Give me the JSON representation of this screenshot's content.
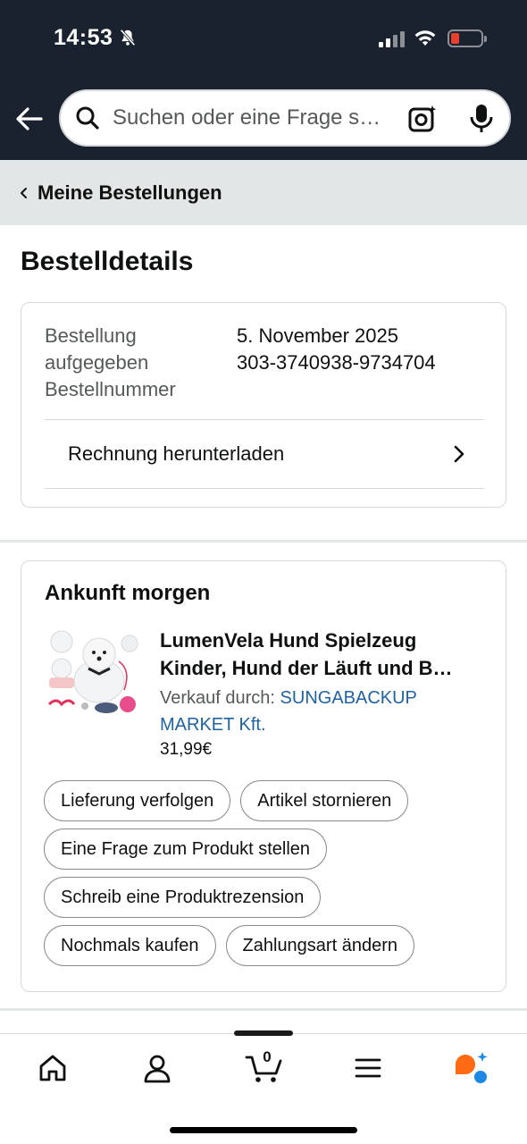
{
  "status_bar": {
    "time": "14:53"
  },
  "search": {
    "placeholder": "Suchen oder eine Frage s…"
  },
  "breadcrumb": {
    "label": "Meine Bestellungen"
  },
  "page": {
    "title": "Bestelldetails"
  },
  "order_info": {
    "label_placed": "Bestellung",
    "label_placed_2": "aufgegeben",
    "label_number": "Bestellnummer",
    "date": "5. November 2025",
    "number": "303-3740938-9734704",
    "invoice_label": "Rechnung herunterladen"
  },
  "shipment": {
    "heading": "Ankunft morgen",
    "product_title": "LumenVela Hund Spielzeug Kinder, Hund der Läuft und B…",
    "seller_prefix": "Verkauf durch: ",
    "seller_name": "SUNGABACKUP MARKET Kft.",
    "price": "31,99€",
    "actions": {
      "track": "Lieferung verfolgen",
      "cancel": "Artikel stornieren",
      "question": "Eine Frage zum Produkt stellen",
      "review": "Schreib eine Produktrezension",
      "buy_again": "Nochmals kaufen",
      "payment": "Zahlungsart ändern"
    }
  },
  "bottom_nav": {
    "cart_count": "0"
  },
  "colors": {
    "header_bg": "#1a2230",
    "link": "#2162a1",
    "breadcrumb_bg": "#e3e6e6",
    "assistant_orange": "#ff6a13",
    "assistant_blue": "#1e88e5"
  },
  "icons": [
    "bell-slash-icon",
    "signal-icon",
    "wifi-icon",
    "battery-icon",
    "back-arrow-icon",
    "search-icon",
    "camera-icon",
    "microphone-icon",
    "chevron-left-icon",
    "chevron-right-icon",
    "home-icon",
    "account-icon",
    "cart-icon",
    "menu-icon",
    "assistant-icon"
  ]
}
